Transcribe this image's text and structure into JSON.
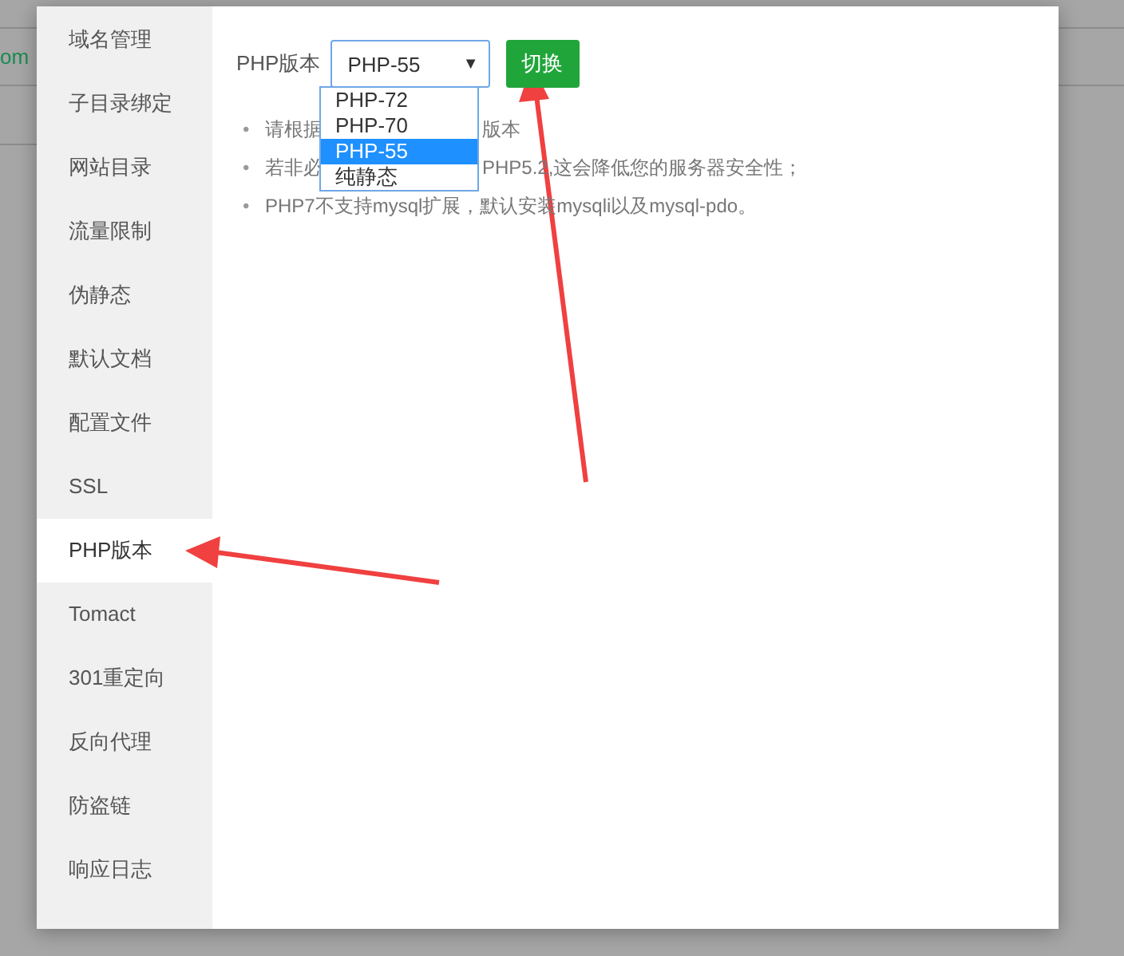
{
  "background": {
    "left_text": "om"
  },
  "sidebar": {
    "items": [
      {
        "label": "域名管理",
        "selected": false
      },
      {
        "label": "子目录绑定",
        "selected": false
      },
      {
        "label": "网站目录",
        "selected": false
      },
      {
        "label": "流量限制",
        "selected": false
      },
      {
        "label": "伪静态",
        "selected": false
      },
      {
        "label": "默认文档",
        "selected": false
      },
      {
        "label": "配置文件",
        "selected": false
      },
      {
        "label": "SSL",
        "selected": false
      },
      {
        "label": "PHP版本",
        "selected": true
      },
      {
        "label": "Tomact",
        "selected": false
      },
      {
        "label": "301重定向",
        "selected": false
      },
      {
        "label": "反向代理",
        "selected": false
      },
      {
        "label": "防盗链",
        "selected": false
      },
      {
        "label": "响应日志",
        "selected": false
      }
    ]
  },
  "php": {
    "label": "PHP版本",
    "value": "PHP-55",
    "caret": "▼",
    "button": "切换",
    "options": [
      {
        "label": "PHP-72",
        "selected": false
      },
      {
        "label": "PHP-70",
        "selected": false
      },
      {
        "label": "PHP-55",
        "selected": true
      },
      {
        "label": "纯静态",
        "selected": false
      }
    ],
    "notes": [
      {
        "bullet": "•",
        "parts": [
          "请根据",
          "版本"
        ]
      },
      {
        "bullet": "•",
        "parts": [
          "若非必",
          "PHP5.2,这会降低您的服务器安全性；"
        ]
      },
      {
        "bullet": "•",
        "parts": [
          "PHP7不支持mysql扩展，默认安装mysqli以及mysql-pdo。"
        ]
      }
    ]
  }
}
